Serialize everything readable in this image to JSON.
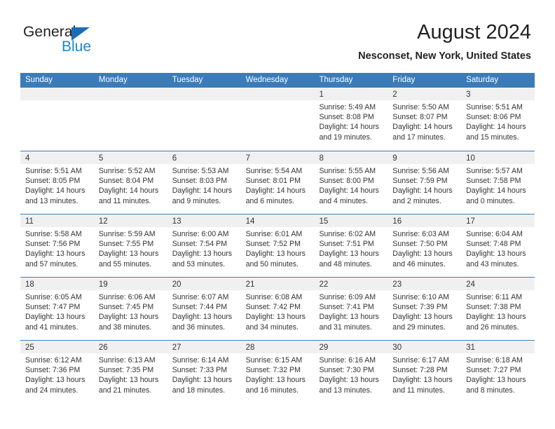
{
  "brand": {
    "name_part1": "General",
    "name_part2": "Blue",
    "triangle_icon": "triangle-icon",
    "accent_color": "#2083d0",
    "triangle_color": "#1c6cb5"
  },
  "header": {
    "month_title": "August 2024",
    "location": "Nesconset, New York, United States"
  },
  "calendar": {
    "header_bg": "#3b7cb8",
    "day_header_bg": "#f0f0f0",
    "weekdays": [
      "Sunday",
      "Monday",
      "Tuesday",
      "Wednesday",
      "Thursday",
      "Friday",
      "Saturday"
    ],
    "weeks": [
      [
        {
          "date": "",
          "empty": true,
          "lines": []
        },
        {
          "date": "",
          "empty": true,
          "lines": []
        },
        {
          "date": "",
          "empty": true,
          "lines": []
        },
        {
          "date": "",
          "empty": true,
          "lines": []
        },
        {
          "date": "1",
          "empty": false,
          "lines": [
            "Sunrise: 5:49 AM",
            "Sunset: 8:08 PM",
            "Daylight: 14 hours",
            "and 19 minutes."
          ]
        },
        {
          "date": "2",
          "empty": false,
          "lines": [
            "Sunrise: 5:50 AM",
            "Sunset: 8:07 PM",
            "Daylight: 14 hours",
            "and 17 minutes."
          ]
        },
        {
          "date": "3",
          "empty": false,
          "lines": [
            "Sunrise: 5:51 AM",
            "Sunset: 8:06 PM",
            "Daylight: 14 hours",
            "and 15 minutes."
          ]
        }
      ],
      [
        {
          "date": "4",
          "empty": false,
          "lines": [
            "Sunrise: 5:51 AM",
            "Sunset: 8:05 PM",
            "Daylight: 14 hours",
            "and 13 minutes."
          ]
        },
        {
          "date": "5",
          "empty": false,
          "lines": [
            "Sunrise: 5:52 AM",
            "Sunset: 8:04 PM",
            "Daylight: 14 hours",
            "and 11 minutes."
          ]
        },
        {
          "date": "6",
          "empty": false,
          "lines": [
            "Sunrise: 5:53 AM",
            "Sunset: 8:03 PM",
            "Daylight: 14 hours",
            "and 9 minutes."
          ]
        },
        {
          "date": "7",
          "empty": false,
          "lines": [
            "Sunrise: 5:54 AM",
            "Sunset: 8:01 PM",
            "Daylight: 14 hours",
            "and 6 minutes."
          ]
        },
        {
          "date": "8",
          "empty": false,
          "lines": [
            "Sunrise: 5:55 AM",
            "Sunset: 8:00 PM",
            "Daylight: 14 hours",
            "and 4 minutes."
          ]
        },
        {
          "date": "9",
          "empty": false,
          "lines": [
            "Sunrise: 5:56 AM",
            "Sunset: 7:59 PM",
            "Daylight: 14 hours",
            "and 2 minutes."
          ]
        },
        {
          "date": "10",
          "empty": false,
          "lines": [
            "Sunrise: 5:57 AM",
            "Sunset: 7:58 PM",
            "Daylight: 14 hours",
            "and 0 minutes."
          ]
        }
      ],
      [
        {
          "date": "11",
          "empty": false,
          "lines": [
            "Sunrise: 5:58 AM",
            "Sunset: 7:56 PM",
            "Daylight: 13 hours",
            "and 57 minutes."
          ]
        },
        {
          "date": "12",
          "empty": false,
          "lines": [
            "Sunrise: 5:59 AM",
            "Sunset: 7:55 PM",
            "Daylight: 13 hours",
            "and 55 minutes."
          ]
        },
        {
          "date": "13",
          "empty": false,
          "lines": [
            "Sunrise: 6:00 AM",
            "Sunset: 7:54 PM",
            "Daylight: 13 hours",
            "and 53 minutes."
          ]
        },
        {
          "date": "14",
          "empty": false,
          "lines": [
            "Sunrise: 6:01 AM",
            "Sunset: 7:52 PM",
            "Daylight: 13 hours",
            "and 50 minutes."
          ]
        },
        {
          "date": "15",
          "empty": false,
          "lines": [
            "Sunrise: 6:02 AM",
            "Sunset: 7:51 PM",
            "Daylight: 13 hours",
            "and 48 minutes."
          ]
        },
        {
          "date": "16",
          "empty": false,
          "lines": [
            "Sunrise: 6:03 AM",
            "Sunset: 7:50 PM",
            "Daylight: 13 hours",
            "and 46 minutes."
          ]
        },
        {
          "date": "17",
          "empty": false,
          "lines": [
            "Sunrise: 6:04 AM",
            "Sunset: 7:48 PM",
            "Daylight: 13 hours",
            "and 43 minutes."
          ]
        }
      ],
      [
        {
          "date": "18",
          "empty": false,
          "lines": [
            "Sunrise: 6:05 AM",
            "Sunset: 7:47 PM",
            "Daylight: 13 hours",
            "and 41 minutes."
          ]
        },
        {
          "date": "19",
          "empty": false,
          "lines": [
            "Sunrise: 6:06 AM",
            "Sunset: 7:45 PM",
            "Daylight: 13 hours",
            "and 38 minutes."
          ]
        },
        {
          "date": "20",
          "empty": false,
          "lines": [
            "Sunrise: 6:07 AM",
            "Sunset: 7:44 PM",
            "Daylight: 13 hours",
            "and 36 minutes."
          ]
        },
        {
          "date": "21",
          "empty": false,
          "lines": [
            "Sunrise: 6:08 AM",
            "Sunset: 7:42 PM",
            "Daylight: 13 hours",
            "and 34 minutes."
          ]
        },
        {
          "date": "22",
          "empty": false,
          "lines": [
            "Sunrise: 6:09 AM",
            "Sunset: 7:41 PM",
            "Daylight: 13 hours",
            "and 31 minutes."
          ]
        },
        {
          "date": "23",
          "empty": false,
          "lines": [
            "Sunrise: 6:10 AM",
            "Sunset: 7:39 PM",
            "Daylight: 13 hours",
            "and 29 minutes."
          ]
        },
        {
          "date": "24",
          "empty": false,
          "lines": [
            "Sunrise: 6:11 AM",
            "Sunset: 7:38 PM",
            "Daylight: 13 hours",
            "and 26 minutes."
          ]
        }
      ],
      [
        {
          "date": "25",
          "empty": false,
          "lines": [
            "Sunrise: 6:12 AM",
            "Sunset: 7:36 PM",
            "Daylight: 13 hours",
            "and 24 minutes."
          ]
        },
        {
          "date": "26",
          "empty": false,
          "lines": [
            "Sunrise: 6:13 AM",
            "Sunset: 7:35 PM",
            "Daylight: 13 hours",
            "and 21 minutes."
          ]
        },
        {
          "date": "27",
          "empty": false,
          "lines": [
            "Sunrise: 6:14 AM",
            "Sunset: 7:33 PM",
            "Daylight: 13 hours",
            "and 18 minutes."
          ]
        },
        {
          "date": "28",
          "empty": false,
          "lines": [
            "Sunrise: 6:15 AM",
            "Sunset: 7:32 PM",
            "Daylight: 13 hours",
            "and 16 minutes."
          ]
        },
        {
          "date": "29",
          "empty": false,
          "lines": [
            "Sunrise: 6:16 AM",
            "Sunset: 7:30 PM",
            "Daylight: 13 hours",
            "and 13 minutes."
          ]
        },
        {
          "date": "30",
          "empty": false,
          "lines": [
            "Sunrise: 6:17 AM",
            "Sunset: 7:28 PM",
            "Daylight: 13 hours",
            "and 11 minutes."
          ]
        },
        {
          "date": "31",
          "empty": false,
          "lines": [
            "Sunrise: 6:18 AM",
            "Sunset: 7:27 PM",
            "Daylight: 13 hours",
            "and 8 minutes."
          ]
        }
      ]
    ]
  }
}
